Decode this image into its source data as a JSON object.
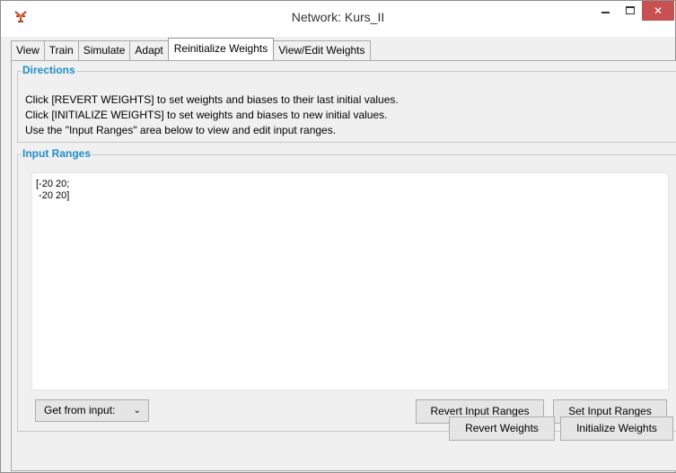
{
  "window": {
    "title": "Network: Kurs_II",
    "minimize_icon": "minimize-icon",
    "maximize_icon": "maximize-icon",
    "close_label": "✕",
    "app_icon": "network-app-icon"
  },
  "tabs": [
    {
      "label": "View"
    },
    {
      "label": "Train"
    },
    {
      "label": "Simulate"
    },
    {
      "label": "Adapt"
    },
    {
      "label": "Reinitialize Weights",
      "active": true
    },
    {
      "label": "View/Edit Weights"
    }
  ],
  "directions": {
    "title": "Directions",
    "lines": [
      "Click [REVERT WEIGHTS] to set weights and biases to their last initial values.",
      "Click [INITIALIZE WEIGHTS] to set weights and biases to new initial values.",
      "Use the \"Input Ranges\" area below to view and edit input ranges."
    ]
  },
  "input_ranges": {
    "title": "Input Ranges",
    "value": "[-20 20;\n -20 20]",
    "source_select": "Get from input:",
    "revert_label": "Revert Input Ranges",
    "set_label": "Set Input Ranges"
  },
  "footer": {
    "revert_weights_label": "Revert Weights",
    "initialize_weights_label": "Initialize Weights"
  },
  "colors": {
    "group_title": "#1e8ec6",
    "close_button": "#c75050"
  }
}
